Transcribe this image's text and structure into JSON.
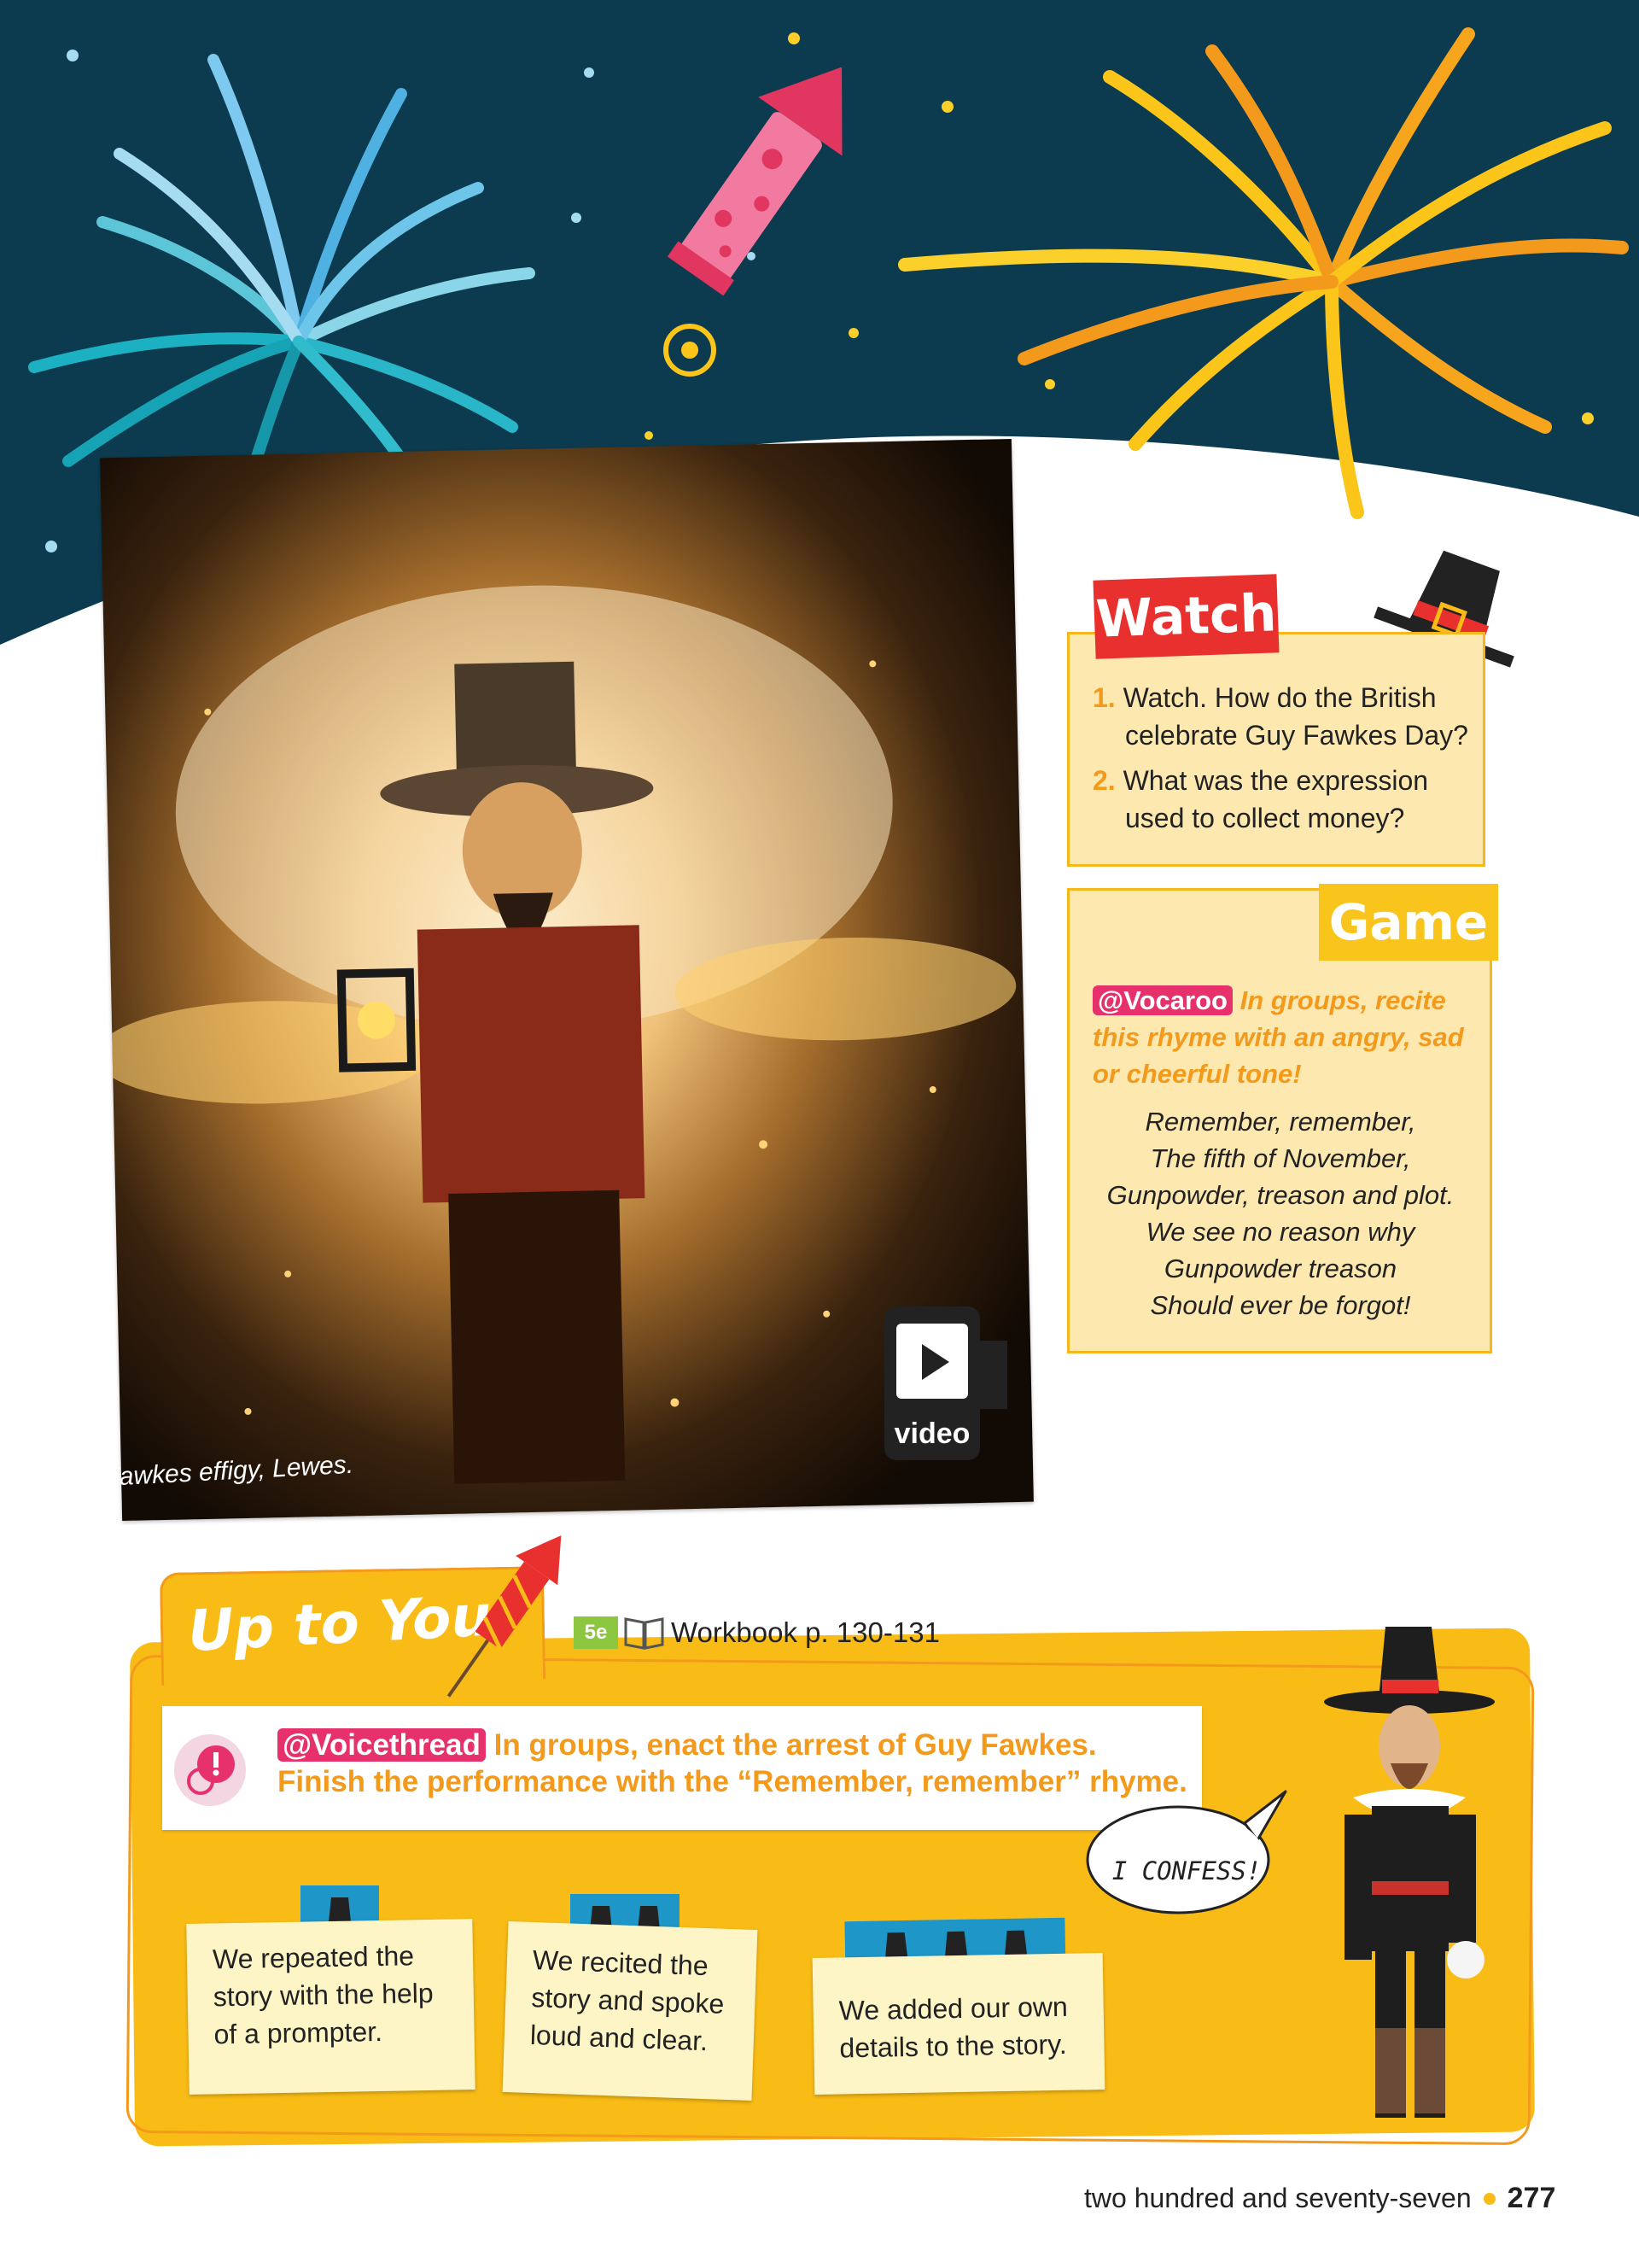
{
  "photo": {
    "caption": "Guy Fawkes effigy, Lewes."
  },
  "video_badge": {
    "label": "video"
  },
  "watch": {
    "tab_label": "Watch",
    "questions": [
      {
        "number": "1.",
        "text_line1": "Watch. How do the British",
        "text_line2": "celebrate Guy Fawkes Day?"
      },
      {
        "number": "2.",
        "text_line1": "What was the expression",
        "text_line2": "used to collect money?"
      }
    ]
  },
  "game": {
    "tab_label": "Game",
    "tool_tag": "@Vocaroo",
    "instruction": "In groups, recite this rhyme with an angry, sad or cheerful tone!",
    "rhyme": [
      "Remember, remember,",
      "The fifth of November,",
      "Gunpowder, treason and plot.",
      "We see no reason why",
      "Gunpowder treason",
      "Should ever be forgot!"
    ]
  },
  "up_to_you": {
    "title": "Up to You!",
    "level_badge": "5e",
    "workbook_ref": "Workbook p. 130-131",
    "tool_tag": "@Voicethread",
    "task": "In groups, enact the arrest of Guy Fawkes. Finish the performance with the “Remember, remember” rhyme.",
    "speech_bubble": "I CONFESS!",
    "levels": [
      {
        "hats": 1,
        "lines": [
          "We repeated the",
          "story with the help",
          "of a prompter."
        ]
      },
      {
        "hats": 2,
        "lines": [
          "We recited the",
          "story and spoke",
          "loud and clear."
        ]
      },
      {
        "hats": 3,
        "lines": [
          "We added our own",
          "details to the story."
        ]
      }
    ]
  },
  "footer": {
    "page_words": "two hundred and seventy-seven",
    "page_number": "277"
  },
  "colors": {
    "sky": "#0c3a4e",
    "accent_red": "#e8312e",
    "accent_yellow": "#f9bc16",
    "accent_orange": "#f39a1c",
    "tag_pink": "#e6316d",
    "hat_blue": "#1e96c8"
  },
  "icons": [
    "fireworks",
    "rocket-icon",
    "pilgrim-hat-icon",
    "video-play-icon",
    "book-icon",
    "alert-bubble-icon"
  ]
}
